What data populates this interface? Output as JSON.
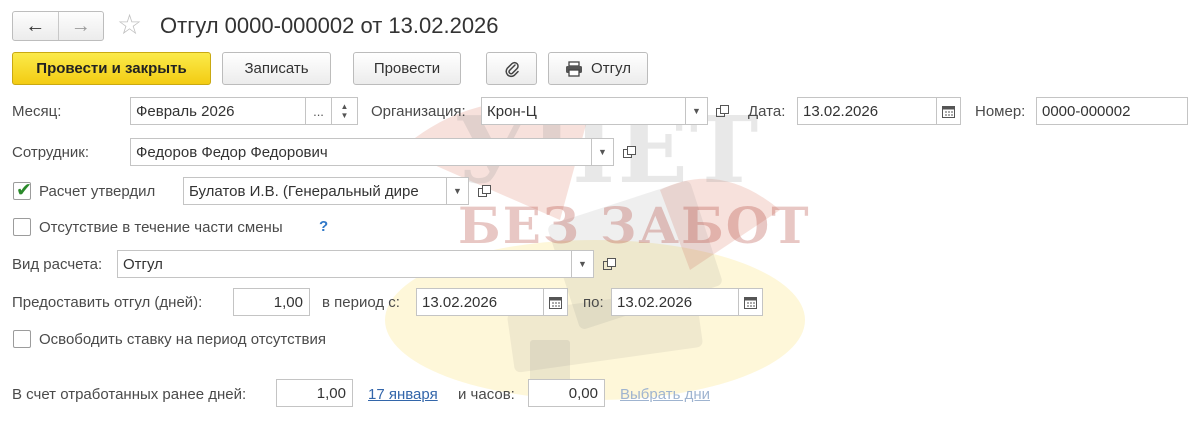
{
  "header": {
    "back_icon": "arrow-left-icon",
    "forward_icon": "arrow-right-icon",
    "favorite_icon": "star-icon",
    "title": "Отгул 0000-000002 от 13.02.2026"
  },
  "toolbar": {
    "post_close_label": "Провести и закрыть",
    "save_label": "Записать",
    "post_label": "Провести",
    "attach_icon": "paperclip-icon",
    "print_label": "Отгул"
  },
  "form": {
    "month_label": "Месяц:",
    "month_value": "Февраль 2026",
    "month_dots": "...",
    "org_label": "Организация:",
    "org_value": "Крон-Ц",
    "date_label": "Дата:",
    "date_value": "13.02.2026",
    "number_label": "Номер:",
    "number_value": "0000-000002",
    "employee_label": "Сотрудник:",
    "employee_value": "Федоров Федор Федорович",
    "approved_label": "Расчет утвердил",
    "approved_checked": true,
    "approved_value": "Булатов И.В. (Генеральный дире",
    "partial_shift_label": "Отсутствие в течение части смены",
    "partial_shift_checked": false,
    "help_mark": "?",
    "calc_type_label": "Вид расчета:",
    "calc_type_value": "Отгул",
    "days_label": "Предоставить отгул (дней):",
    "days_value": "1,00",
    "period_from_label": "в период с:",
    "period_from_value": "13.02.2026",
    "period_to_label": "по:",
    "period_to_value": "13.02.2026",
    "free_rate_label": "Освободить ставку на период отсутствия",
    "free_rate_checked": false,
    "worked_days_label": "В счет отработанных ранее дней:",
    "worked_days_value": "1,00",
    "worked_date_link": "17 января",
    "hours_label": "и часов:",
    "hours_value": "0,00",
    "choose_days_link": "Выбрать дни"
  },
  "watermark": {
    "title": "УЧЕТ",
    "subtitle": "БЕЗ ЗАБОТ"
  }
}
